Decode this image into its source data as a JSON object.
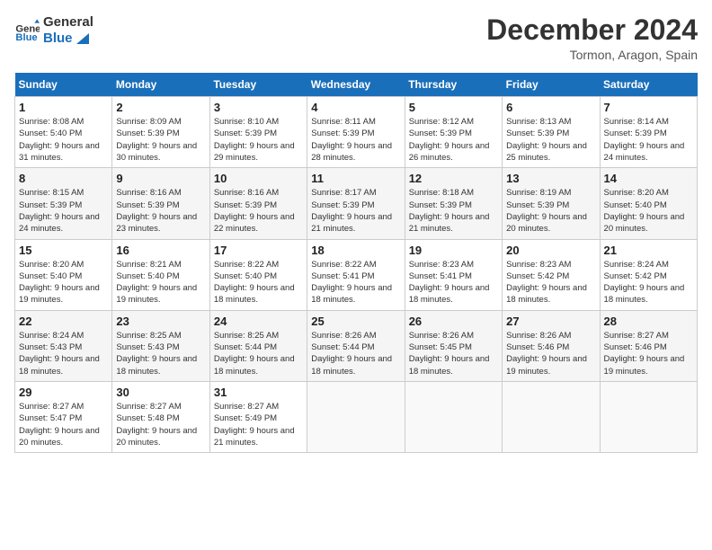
{
  "logo": {
    "line1": "General",
    "line2": "Blue"
  },
  "title": "December 2024",
  "location": "Tormon, Aragon, Spain",
  "days_header": [
    "Sunday",
    "Monday",
    "Tuesday",
    "Wednesday",
    "Thursday",
    "Friday",
    "Saturday"
  ],
  "weeks": [
    [
      {
        "day": "1",
        "sunrise": "8:08 AM",
        "sunset": "5:40 PM",
        "daylight": "9 hours and 31 minutes."
      },
      {
        "day": "2",
        "sunrise": "8:09 AM",
        "sunset": "5:39 PM",
        "daylight": "9 hours and 30 minutes."
      },
      {
        "day": "3",
        "sunrise": "8:10 AM",
        "sunset": "5:39 PM",
        "daylight": "9 hours and 29 minutes."
      },
      {
        "day": "4",
        "sunrise": "8:11 AM",
        "sunset": "5:39 PM",
        "daylight": "9 hours and 28 minutes."
      },
      {
        "day": "5",
        "sunrise": "8:12 AM",
        "sunset": "5:39 PM",
        "daylight": "9 hours and 26 minutes."
      },
      {
        "day": "6",
        "sunrise": "8:13 AM",
        "sunset": "5:39 PM",
        "daylight": "9 hours and 25 minutes."
      },
      {
        "day": "7",
        "sunrise": "8:14 AM",
        "sunset": "5:39 PM",
        "daylight": "9 hours and 24 minutes."
      }
    ],
    [
      {
        "day": "8",
        "sunrise": "8:15 AM",
        "sunset": "5:39 PM",
        "daylight": "9 hours and 24 minutes."
      },
      {
        "day": "9",
        "sunrise": "8:16 AM",
        "sunset": "5:39 PM",
        "daylight": "9 hours and 23 minutes."
      },
      {
        "day": "10",
        "sunrise": "8:16 AM",
        "sunset": "5:39 PM",
        "daylight": "9 hours and 22 minutes."
      },
      {
        "day": "11",
        "sunrise": "8:17 AM",
        "sunset": "5:39 PM",
        "daylight": "9 hours and 21 minutes."
      },
      {
        "day": "12",
        "sunrise": "8:18 AM",
        "sunset": "5:39 PM",
        "daylight": "9 hours and 21 minutes."
      },
      {
        "day": "13",
        "sunrise": "8:19 AM",
        "sunset": "5:39 PM",
        "daylight": "9 hours and 20 minutes."
      },
      {
        "day": "14",
        "sunrise": "8:20 AM",
        "sunset": "5:40 PM",
        "daylight": "9 hours and 20 minutes."
      }
    ],
    [
      {
        "day": "15",
        "sunrise": "8:20 AM",
        "sunset": "5:40 PM",
        "daylight": "9 hours and 19 minutes."
      },
      {
        "day": "16",
        "sunrise": "8:21 AM",
        "sunset": "5:40 PM",
        "daylight": "9 hours and 19 minutes."
      },
      {
        "day": "17",
        "sunrise": "8:22 AM",
        "sunset": "5:40 PM",
        "daylight": "9 hours and 18 minutes."
      },
      {
        "day": "18",
        "sunrise": "8:22 AM",
        "sunset": "5:41 PM",
        "daylight": "9 hours and 18 minutes."
      },
      {
        "day": "19",
        "sunrise": "8:23 AM",
        "sunset": "5:41 PM",
        "daylight": "9 hours and 18 minutes."
      },
      {
        "day": "20",
        "sunrise": "8:23 AM",
        "sunset": "5:42 PM",
        "daylight": "9 hours and 18 minutes."
      },
      {
        "day": "21",
        "sunrise": "8:24 AM",
        "sunset": "5:42 PM",
        "daylight": "9 hours and 18 minutes."
      }
    ],
    [
      {
        "day": "22",
        "sunrise": "8:24 AM",
        "sunset": "5:43 PM",
        "daylight": "9 hours and 18 minutes."
      },
      {
        "day": "23",
        "sunrise": "8:25 AM",
        "sunset": "5:43 PM",
        "daylight": "9 hours and 18 minutes."
      },
      {
        "day": "24",
        "sunrise": "8:25 AM",
        "sunset": "5:44 PM",
        "daylight": "9 hours and 18 minutes."
      },
      {
        "day": "25",
        "sunrise": "8:26 AM",
        "sunset": "5:44 PM",
        "daylight": "9 hours and 18 minutes."
      },
      {
        "day": "26",
        "sunrise": "8:26 AM",
        "sunset": "5:45 PM",
        "daylight": "9 hours and 18 minutes."
      },
      {
        "day": "27",
        "sunrise": "8:26 AM",
        "sunset": "5:46 PM",
        "daylight": "9 hours and 19 minutes."
      },
      {
        "day": "28",
        "sunrise": "8:27 AM",
        "sunset": "5:46 PM",
        "daylight": "9 hours and 19 minutes."
      }
    ],
    [
      {
        "day": "29",
        "sunrise": "8:27 AM",
        "sunset": "5:47 PM",
        "daylight": "9 hours and 20 minutes."
      },
      {
        "day": "30",
        "sunrise": "8:27 AM",
        "sunset": "5:48 PM",
        "daylight": "9 hours and 20 minutes."
      },
      {
        "day": "31",
        "sunrise": "8:27 AM",
        "sunset": "5:49 PM",
        "daylight": "9 hours and 21 minutes."
      },
      null,
      null,
      null,
      null
    ]
  ]
}
